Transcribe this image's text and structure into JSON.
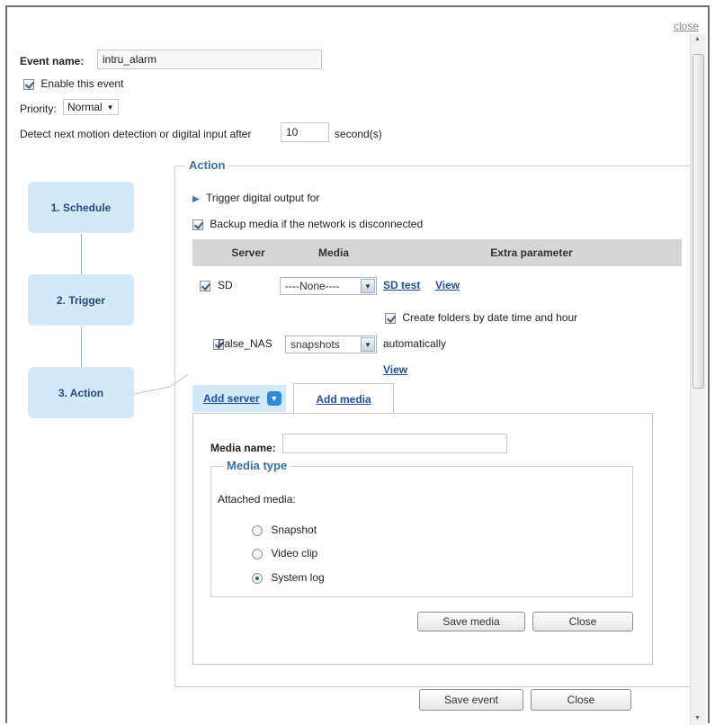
{
  "dialog": {
    "close_link": "close"
  },
  "event": {
    "name_label": "Event name:",
    "name_value": "intru_alarm",
    "enable_label": "Enable this event",
    "enable_checked": true,
    "priority_label": "Priority:",
    "priority_value": "Normal",
    "detect_label": "Detect next motion detection or digital input after",
    "detect_value": "10",
    "detect_unit": "second(s)"
  },
  "steps": [
    {
      "label": "1.  Schedule"
    },
    {
      "label": "2.  Trigger"
    },
    {
      "label": "3.  Action"
    }
  ],
  "action": {
    "legend": "Action",
    "trigger_digital": "Trigger digital output for",
    "backup_label": "Backup media if the network is disconnected",
    "backup_checked": true,
    "table_headers": [
      "Server",
      "Media",
      "Extra parameter"
    ],
    "rows": [
      {
        "checked": true,
        "server": "SD",
        "media": "----None----",
        "sd_test": "SD test",
        "view": "View",
        "create_folders": "Create folders by date time and hour",
        "create_folders_checked": true
      },
      {
        "checked": true,
        "server": "False_NAS",
        "media": "snapshots",
        "extra": "automatically",
        "view": "View"
      }
    ]
  },
  "tabs": {
    "add_server": "Add server",
    "add_media": "Add media"
  },
  "media_form": {
    "name_label": "Media name:",
    "name_value": "",
    "type_legend": "Media type",
    "attached_label": "Attached media:",
    "options": [
      {
        "label": "Snapshot",
        "selected": false
      },
      {
        "label": "Video clip",
        "selected": false
      },
      {
        "label": "System log",
        "selected": true
      }
    ],
    "save_button": "Save media",
    "close_button": "Close"
  },
  "footer": {
    "save_event": "Save event",
    "close": "Close"
  }
}
